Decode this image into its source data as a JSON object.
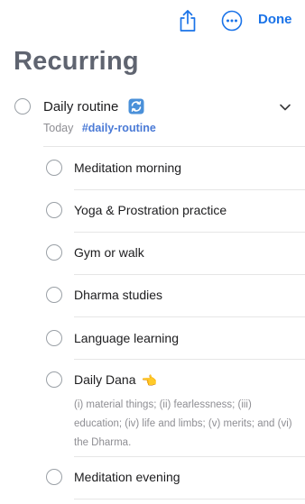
{
  "toolbar": {
    "share_icon": "share-icon",
    "more_icon": "more-icon",
    "done_label": "Done",
    "accent_color": "#1a73e8"
  },
  "page": {
    "title": "Recurring"
  },
  "parent_task": {
    "title": "Daily routine",
    "repeat_icon": "repeat-icon",
    "date": "Today",
    "tag": "#daily-routine",
    "expand_icon": "chevron-down-icon"
  },
  "subtasks": [
    {
      "label": "Meditation morning"
    },
    {
      "label": "Yoga & Prostration practice"
    },
    {
      "label": "Gym or walk"
    },
    {
      "label": "Dharma studies"
    },
    {
      "label": "Language learning"
    },
    {
      "label": "Daily Dana",
      "icon": "pointing-hand-icon",
      "description": "(i) material things; (ii) fearlessness; (iii) education; (iv) life and limbs; (v) merits; and (vi) the Dharma."
    },
    {
      "label": "Meditation evening"
    }
  ]
}
